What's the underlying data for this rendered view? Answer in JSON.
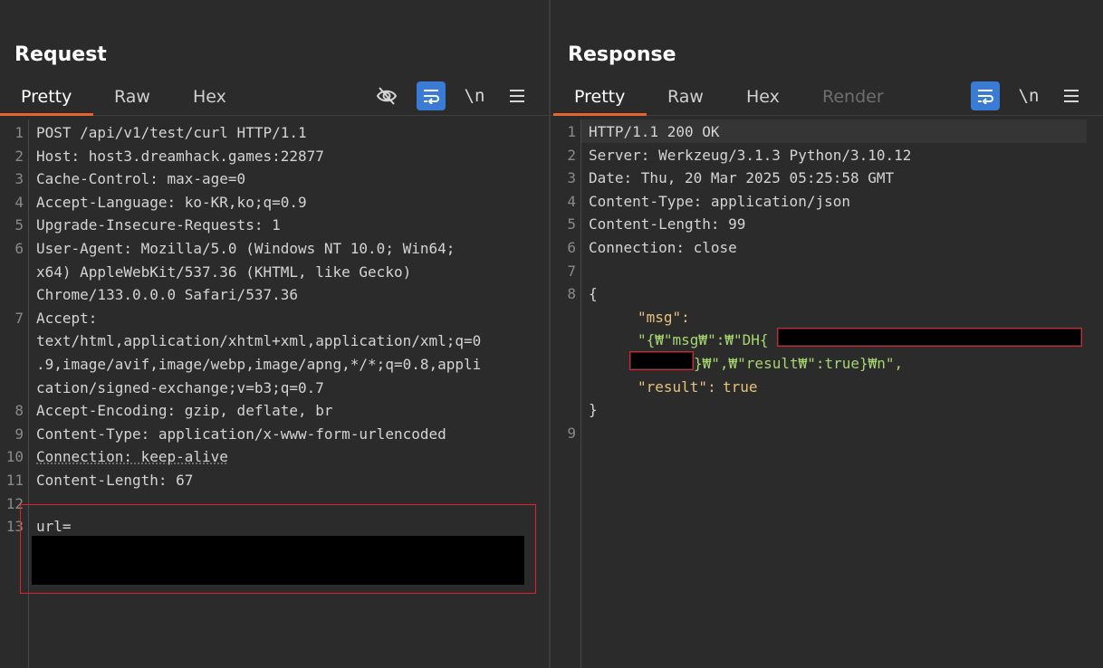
{
  "layout_switch": [
    {
      "name": "split-vertical",
      "active": true
    },
    {
      "name": "split-horizontal",
      "active": false
    },
    {
      "name": "single-pane",
      "active": false
    }
  ],
  "request": {
    "title": "Request",
    "tabs": [
      {
        "label": "Pretty",
        "active": true
      },
      {
        "label": "Raw",
        "active": false
      },
      {
        "label": "Hex",
        "active": false
      }
    ],
    "tools": {
      "hide_icon": "eye-slash-icon",
      "wrap_icon": "text-wrap-icon",
      "newline_label": "\\n",
      "menu_icon": "hamburger-menu-icon"
    },
    "line_numbers": [
      "1",
      "2",
      "3",
      "4",
      "5",
      "6",
      "7",
      "8",
      "9",
      "10",
      "11",
      "12",
      "13"
    ],
    "lines": [
      "POST /api/v1/test/curl HTTP/1.1",
      "Host: host3.dreamhack.games:22877",
      "Cache-Control: max-age=0",
      "Accept-Language: ko-KR,ko;q=0.9",
      "Upgrade-Insecure-Requests: 1",
      "User-Agent: Mozilla/5.0 (Windows NT 10.0; Win64;",
      "x64) AppleWebKit/537.36 (KHTML, like Gecko)",
      "Chrome/133.0.0.0 Safari/537.36",
      "Accept:",
      "text/html,application/xhtml+xml,application/xml;q=0",
      ".9,image/avif,image/webp,image/apng,*/*;q=0.8,appli",
      "cation/signed-exchange;v=b3;q=0.7",
      "Accept-Encoding: gzip, deflate, br",
      "Content-Type: application/x-www-form-urlencoded",
      "Connection: keep-alive",
      "Content-Length: 67",
      "",
      "url="
    ]
  },
  "response": {
    "title": "Response",
    "tabs": [
      {
        "label": "Pretty",
        "active": true
      },
      {
        "label": "Raw",
        "active": false
      },
      {
        "label": "Hex",
        "active": false
      },
      {
        "label": "Render",
        "active": false,
        "disabled": true
      }
    ],
    "tools": {
      "wrap_icon": "text-wrap-icon",
      "newline_label": "\\n",
      "menu_icon": "hamburger-menu-icon"
    },
    "line_numbers": [
      "1",
      "2",
      "3",
      "4",
      "5",
      "6",
      "7",
      "8",
      "9"
    ],
    "lines": [
      "HTTP/1.1 200 OK",
      "Server: Werkzeug/3.1.3 Python/3.10.12",
      "Date: Thu, 20 Mar 2025 05:25:58 GMT",
      "Content-Type: application/json",
      "Content-Length: 99",
      "Connection: close",
      "",
      "{"
    ],
    "json_body": {
      "msg_key": "\"msg\":",
      "msg_value_start": "\"{₩\"msg₩\":₩\"DH{",
      "msg_value_end": "}₩\",₩\"result₩\":true}₩n\",",
      "result_key": "\"result\":",
      "result_value": "true",
      "close": "}"
    }
  },
  "colors": {
    "background": "#2b2b2b",
    "accent": "#3a7bd5",
    "tab_underline": "#e8632f",
    "redaction_border": "#e0202a",
    "json_key": "#e8c17a",
    "json_string": "#a5d56f"
  }
}
